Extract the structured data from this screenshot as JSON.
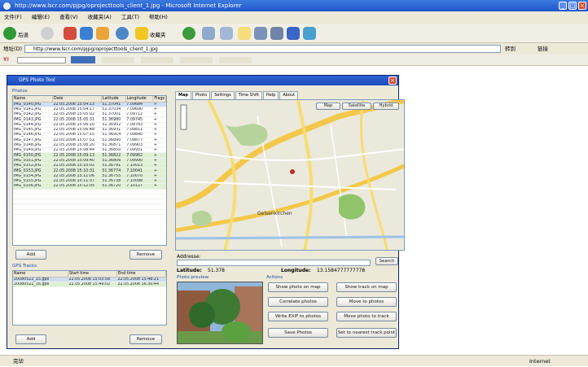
{
  "browser": {
    "title": "http://www.lscr.com/pjpg/oprojecttools_client_1.jpg - Microsoft Internet Explorer",
    "menu": [
      "文件(F)",
      "编辑(E)",
      "查看(V)",
      "收藏夹(A)",
      "工具(T)",
      "帮助(H)"
    ],
    "toolbar": {
      "back_label": "后退",
      "favorites_label": "收藏夹"
    },
    "address_label": "地址(D)",
    "address_value": "http://www.lscr.com/pjpg/oprojecttools_client_1.jpg",
    "go_label": "转到",
    "links_label": "链接",
    "status_text": "完毕",
    "zone_text": "Internet"
  },
  "app": {
    "title": "GPS Photo Tool",
    "photos_group_label": "Photos",
    "photos_columns": [
      "Name",
      "Date",
      "Latitude",
      "Longitude",
      "Flags"
    ],
    "photos_rows": [
      [
        "IMG_0140.JPG",
        "22.05.2008 15:04:13",
        "51.37041",
        "7.09684",
        "+"
      ],
      [
        "IMG_0141.JPG",
        "22.05.2008 15:04:17",
        "51.37034",
        "7.09690",
        "+"
      ],
      [
        "IMG_0142.JPG",
        "22.05.2008 15:05:02",
        "51.37001",
        "7.09712",
        "+"
      ],
      [
        "IMG_0143.JPG",
        "22.05.2008 15:05:31",
        "51.36980",
        "7.09745",
        "+"
      ],
      [
        "IMG_0144.JPG",
        "22.05.2008 15:06:10",
        "51.36952",
        "7.09783",
        "+"
      ],
      [
        "IMG_0145.JPG",
        "22.05.2008 15:06:48",
        "51.36931",
        "7.09811",
        "+"
      ],
      [
        "IMG_0146.JPG",
        "22.05.2008 15:07:15",
        "51.36914",
        "7.09840",
        "+"
      ],
      [
        "IMG_0147.JPG",
        "22.05.2008 15:07:52",
        "51.36890",
        "7.09877",
        "+"
      ],
      [
        "IMG_0148.JPG",
        "22.05.2008 15:08:20",
        "51.36871",
        "7.09903",
        "+"
      ],
      [
        "IMG_0149.JPG",
        "22.05.2008 15:08:44",
        "51.36850",
        "7.09931",
        "+"
      ],
      [
        "IMG_0150.JPG",
        "22.05.2008 15:09:13",
        "51.36822",
        "7.09962",
        "+"
      ],
      [
        "IMG_0151.JPG",
        "22.05.2008 15:09:40",
        "51.36806",
        "7.09990",
        "+"
      ],
      [
        "IMG_0152.JPG",
        "22.05.2008 15:10:02",
        "51.36791",
        "7.10013",
        "+"
      ],
      [
        "IMG_0153.JPG",
        "22.05.2008 15:10:31",
        "51.36774",
        "7.10041",
        "+"
      ],
      [
        "IMG_0154.JPG",
        "22.05.2008 15:11:06",
        "51.36755",
        "7.10070",
        "+"
      ],
      [
        "IMG_0155.JPG",
        "22.05.2008 15:11:37",
        "51.36738",
        "7.10098",
        "+"
      ],
      [
        "IMG_0156.JPG",
        "22.05.2008 15:12:05",
        "51.36720",
        "7.10127",
        "+"
      ]
    ],
    "add_label": "Add",
    "remove_label": "Remove",
    "gps_group_label": "GPS Tracks",
    "gps_columns": [
      "Name",
      "Start time",
      "End time"
    ],
    "gps_rows": [
      [
        "20080522_15.gpx",
        "22.05.2008 15:03:58",
        "22.05.2008 15:48:21"
      ],
      [
        "20080522_16.gpx",
        "22.05.2008 15:49:02",
        "22.05.2008 16:30:44"
      ]
    ],
    "gps_add_label": "Add",
    "gps_remove_label": "Remove",
    "tabs": [
      "Map",
      "Photo",
      "Settings",
      "Time Shift",
      "Help",
      "About"
    ],
    "map_type_buttons": [
      "Map",
      "Satellite",
      "Hybrid"
    ],
    "map_city_label": "Gelsenkirchen",
    "address_field_label": "Addresse:",
    "search_label": "Search",
    "latitude_label": "Latitude:",
    "latitude_value": "51.378",
    "longitude_label": "Longitude:",
    "longitude_value": "13.1584777777778",
    "photo_preview_label": "Photo preview",
    "actions_label": "Actions",
    "actions": [
      [
        "Show photo on map",
        "Show track on map"
      ],
      [
        "Correlate photos",
        "Move to photos"
      ],
      [
        "Write EXIF to photos",
        "Move photo to track"
      ],
      [
        "Save Photos",
        "Set to nearest track point"
      ]
    ]
  }
}
